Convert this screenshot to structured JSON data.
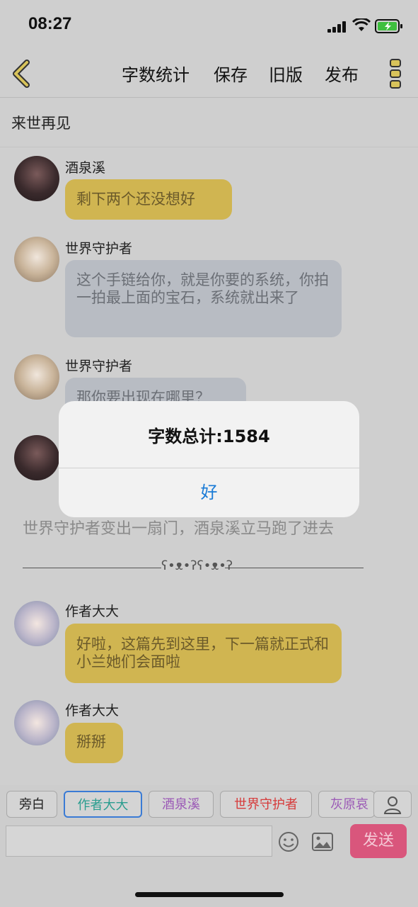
{
  "status_bar": {
    "time": "08:27"
  },
  "toolbar": {
    "word_count_label": "字数统计",
    "save_label": "保存",
    "old_version_label": "旧版",
    "publish_label": "发布"
  },
  "story_title": "来世再见",
  "messages": [
    {
      "sender": "酒泉溪",
      "text": "剩下两个还没想好"
    },
    {
      "sender": "世界守护者",
      "text": "这个手链给你，就是你要的系统，你拍一拍最上面的宝石，系统就出来了"
    },
    {
      "sender": "世界守护者",
      "text": "那你要出现在哪里？"
    },
    {
      "sender": "作者大大",
      "text": "好啦，这篇先到这里，下一篇就正式和小兰她们会面啦"
    },
    {
      "sender": "作者大大",
      "text": "掰掰"
    }
  ],
  "narration": "世界守护者变出一扇门，酒泉溪立马跑了进去",
  "separator_text": "ʕ•ᴥ•ʔʕ•ᴥ•ʔ",
  "characters": [
    {
      "label": "旁白",
      "color": "#222222"
    },
    {
      "label": "作者大大",
      "color": "#2a9d8f"
    },
    {
      "label": "酒泉溪",
      "color": "#9b59b6"
    },
    {
      "label": "世界守护者",
      "color": "#d63a3a"
    },
    {
      "label": "灰原哀",
      "color": "#9b59b6"
    }
  ],
  "input": {
    "value": ""
  },
  "send_label": "发送",
  "dialog": {
    "title": "字数总计:1584",
    "ok_label": "好"
  },
  "colors": {
    "accent_yellow": "#d0b551",
    "send_pink": "#d9567c",
    "link_blue": "#1a7bd6"
  }
}
